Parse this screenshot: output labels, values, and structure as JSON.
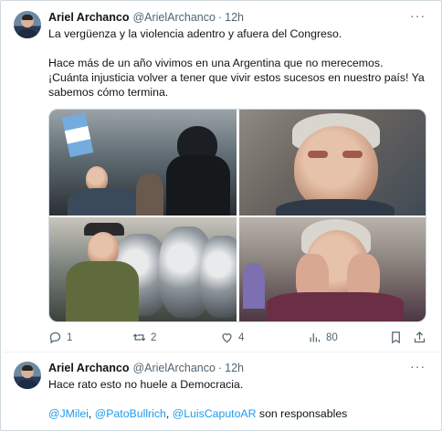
{
  "tweets": [
    {
      "author_name": "Ariel Archanco",
      "handle": "@ArielArchanco",
      "separator": "·",
      "time": "12h",
      "more_label": "···",
      "text_lines": [
        "La vergüenza y la violencia adentro y afuera del Congreso.",
        "Hace más de un año vivimos en una Argentina que no merecemos.",
        "¡Cuánta injusticia volver a tener que vivir estos sucesos en nuestro país! Ya",
        "sabemos cómo termina."
      ],
      "media": [
        "police-and-protesters-photo",
        "injured-elderly-man-photo",
        "elderly-man-facing-police-shields-photo",
        "crying-elderly-woman-photo"
      ],
      "actions": {
        "replies": "1",
        "reposts": "2",
        "likes": "4",
        "views": "80"
      }
    },
    {
      "author_name": "Ariel Archanco",
      "handle": "@ArielArchanco",
      "separator": "·",
      "time": "12h",
      "more_label": "···",
      "text": "Hace rato esto no huele a Democracia.",
      "mentions": [
        "@JMilei",
        "@PatoBullrich",
        "@LuisCaputoAR"
      ],
      "mention_separator": ",",
      "suffix": "son responsables"
    }
  ],
  "colors": {
    "accent": "#1d9bf0",
    "text_primary": "#0f1419",
    "text_secondary": "#536471",
    "border": "#cfd9de"
  }
}
